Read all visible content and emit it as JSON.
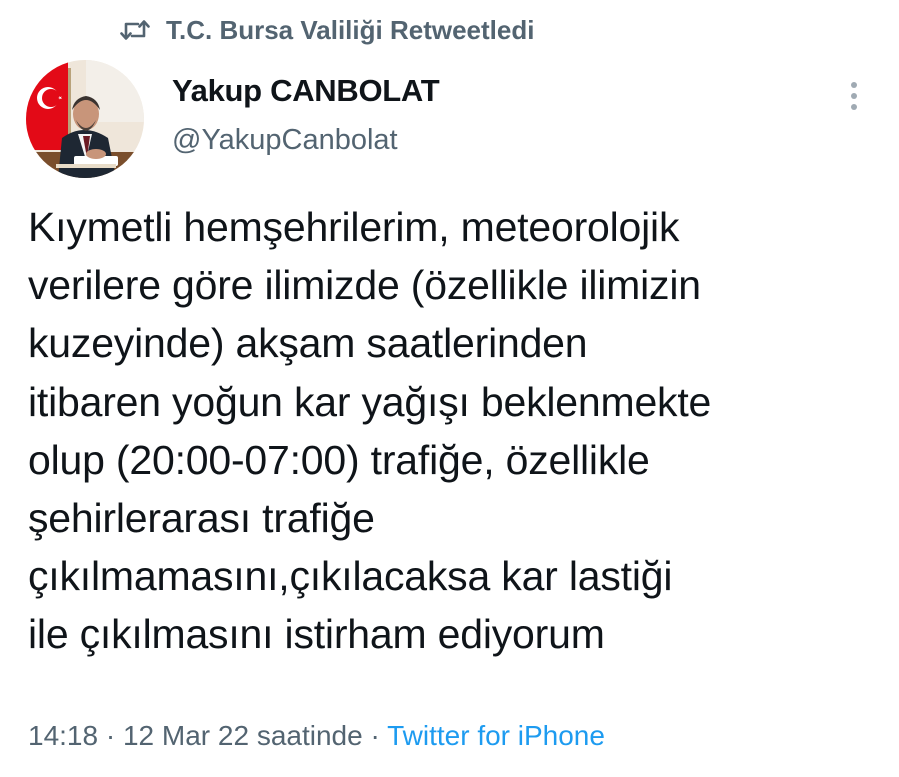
{
  "retweet": {
    "text": "T.C. Bursa Valiliği Retweetledi",
    "icon": "retweet-icon"
  },
  "author": {
    "name": "Yakup CANBOLAT",
    "handle": "@YakupCanbolat",
    "avatar_icon": "profile-photo"
  },
  "menu": {
    "icon": "more-vertical-icon"
  },
  "tweet": {
    "text": "Kıymetli hemşehrilerim, meteorolojik\nverilere göre ilimizde (özellikle ilimizin\nkuzeyinde) akşam saatlerinden\nitibaren yoğun kar yağışı beklenmekte\nolup (20:00-07:00) trafiğe, özellikle\nşehirlerarası trafiğe\nçıkılmamasını,çıkılacaksa kar lastiği\nile çıkılmasını istirham ediyorum"
  },
  "meta": {
    "time": "14:18",
    "separator": "·",
    "date": "12 Mar 22 saatinde",
    "source": "Twitter for iPhone"
  },
  "colors": {
    "text_primary": "#0f1419",
    "text_secondary": "#536471",
    "link": "#1d9bf0",
    "flag_red": "#e30a17"
  }
}
